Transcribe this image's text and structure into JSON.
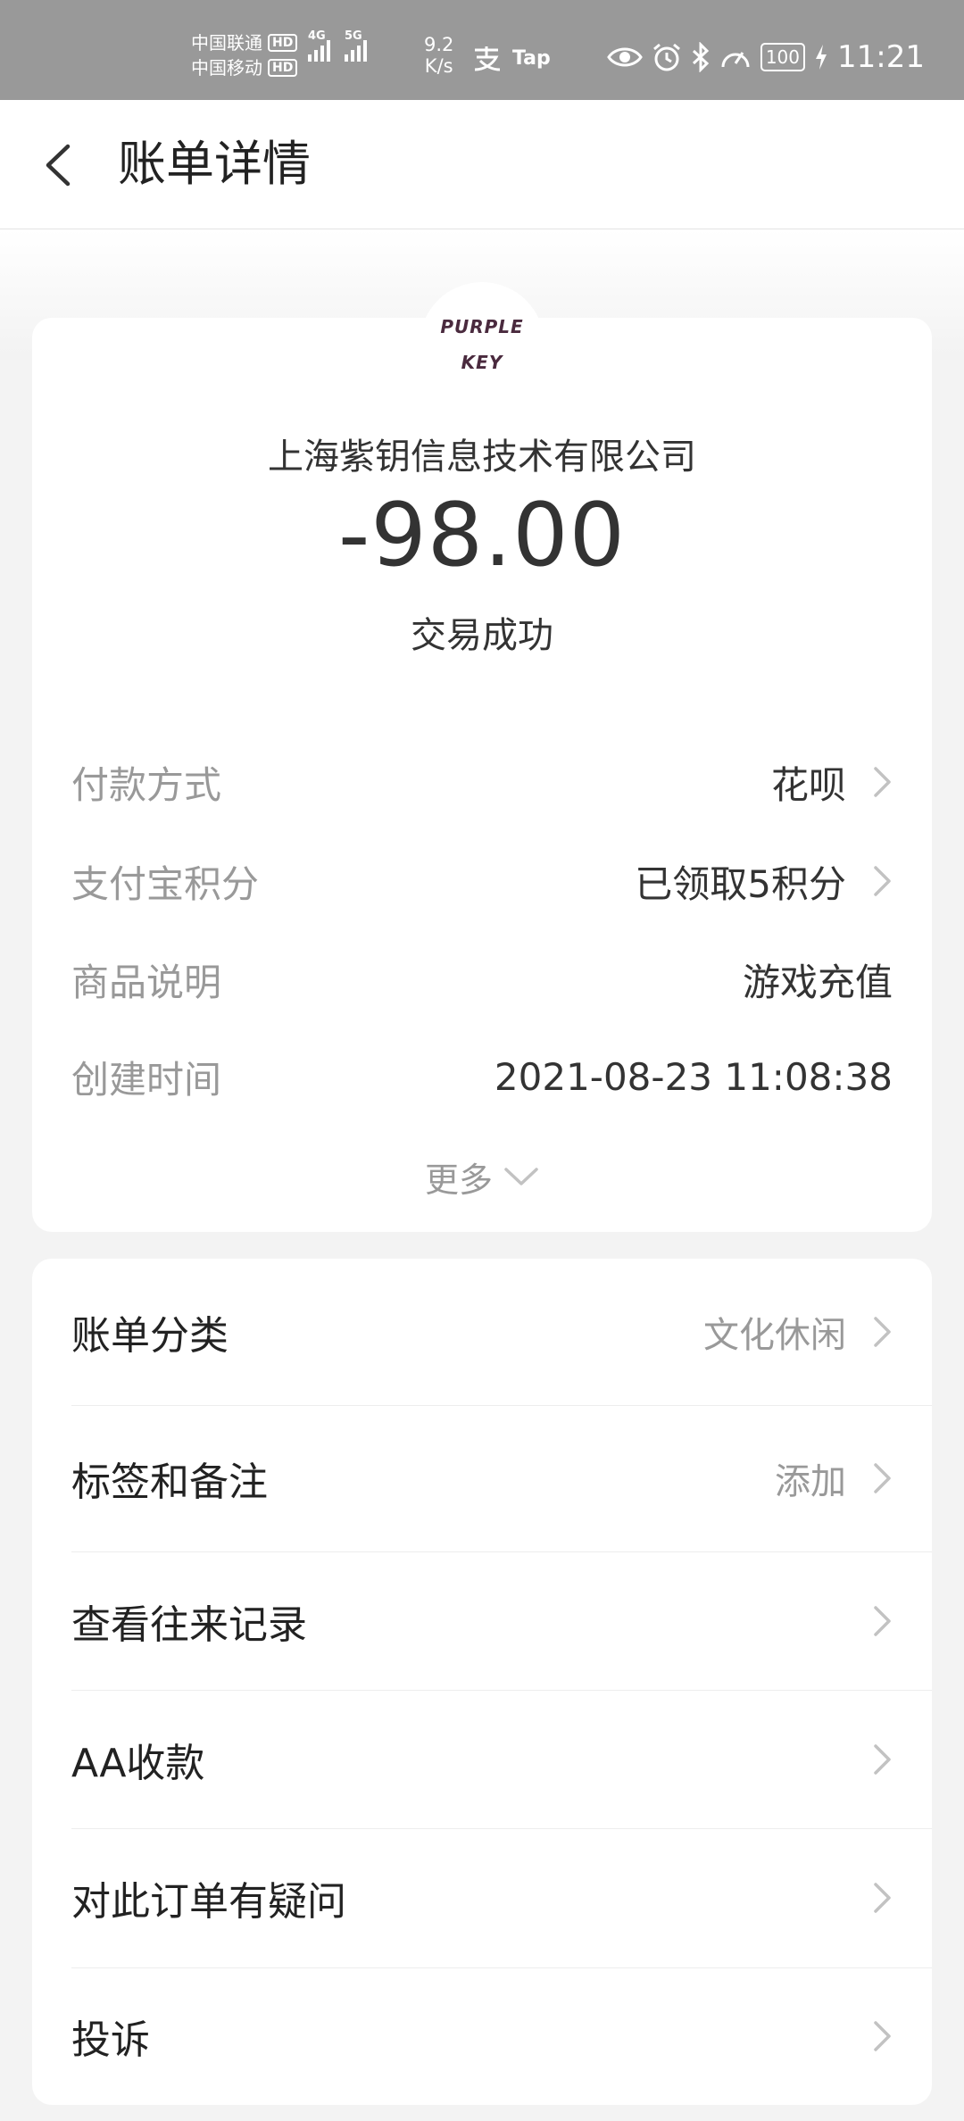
{
  "status_bar": {
    "carrier_1": "中国联通",
    "carrier_2": "中国移动",
    "hd": "HD",
    "net_4g": "4G",
    "net_5g": "5G",
    "speed_value": "9.2",
    "speed_unit": "K/s",
    "app_tap": "Tap",
    "battery": "100",
    "time": "11:21"
  },
  "nav": {
    "title": "账单详情"
  },
  "merchant": {
    "logo_line1": "PURPLE",
    "logo_line2": "KEY",
    "name": "上海紫钥信息技术有限公司",
    "amount": "-98.00",
    "status": "交易成功"
  },
  "details": [
    {
      "label": "付款方式",
      "value": "花呗"
    },
    {
      "label": "支付宝积分",
      "value": "已领取5积分"
    },
    {
      "label": "商品说明",
      "value": "游戏充值"
    },
    {
      "label": "创建时间",
      "value": "2021-08-23 11:08:38"
    }
  ],
  "more_label": "更多",
  "menu": [
    {
      "label": "账单分类",
      "value": "文化休闲"
    },
    {
      "label": "标签和备注",
      "value": "添加"
    },
    {
      "label": "查看往来记录",
      "value": ""
    },
    {
      "label": "AA收款",
      "value": ""
    },
    {
      "label": "对此订单有疑问",
      "value": ""
    },
    {
      "label": "投诉",
      "value": ""
    }
  ]
}
